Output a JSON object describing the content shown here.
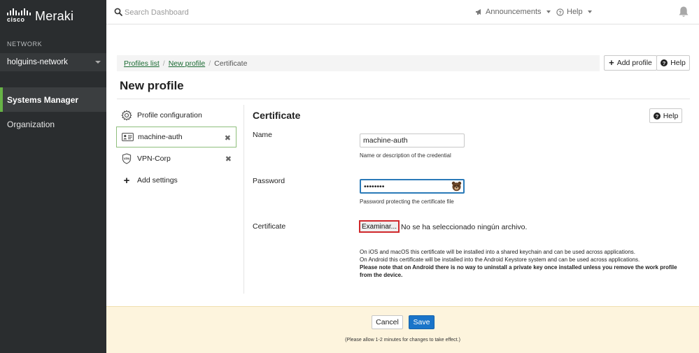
{
  "brand": {
    "cisco": "cisco",
    "product": "Meraki"
  },
  "sidebar": {
    "network_label": "NETWORK",
    "network_name": "holguins-network",
    "items": [
      {
        "label": "Systems Manager",
        "active": true
      },
      {
        "label": "Organization",
        "active": false
      }
    ]
  },
  "header": {
    "search_placeholder": "Search Dashboard",
    "announcements": "Announcements",
    "help": "Help"
  },
  "breadcrumb": {
    "profiles_list": "Profiles list",
    "new_profile": "New profile",
    "current": "Certificate"
  },
  "actions": {
    "add_profile": "Add profile",
    "help": "Help"
  },
  "page_title": "New profile",
  "left_nav": {
    "profile_configuration": "Profile configuration",
    "machine_auth": "machine-auth",
    "vpn_corp": "VPN-Corp",
    "add_settings": "Add settings",
    "remove_glyph": "✖"
  },
  "form": {
    "section_title": "Certificate",
    "help": "Help",
    "name_label": "Name",
    "name_value": "machine-auth",
    "name_hint": "Name or description of the credential",
    "password_label": "Password",
    "password_value": "••••••••",
    "password_hint": "Password protecting the certificate file",
    "certificate_label": "Certificate",
    "file_button": "Examinar...",
    "file_status": "No se ha seleccionado ningún archivo.",
    "note_ios": "On iOS and macOS this certificate will be installed into a shared keychain and can be used across applications.",
    "note_android": "On Android this certificate will be installed into the Android Keystore system and can be used across applications.",
    "note_warning": "Please note that on Android there is no way to uninstall a private key once installed unless you remove the work profile from the device."
  },
  "footer": {
    "cancel": "Cancel",
    "save": "Save",
    "note": "(Please allow 1-2 minutes for changes to take effect.)"
  },
  "colors": {
    "sidebar_bg": "#2a2d2f",
    "active_accent": "#67b346",
    "link_green": "#1a6a32",
    "save_blue": "#1a74c9",
    "footer_bg": "#fdf4dd",
    "highlight_red": "#d0282b"
  },
  "icons": [
    "search-icon",
    "announcements-icon",
    "help-circle-icon",
    "bell-icon",
    "plus-icon",
    "gear-icon",
    "id-card-icon",
    "vpn-shield-icon",
    "bear-icon"
  ]
}
